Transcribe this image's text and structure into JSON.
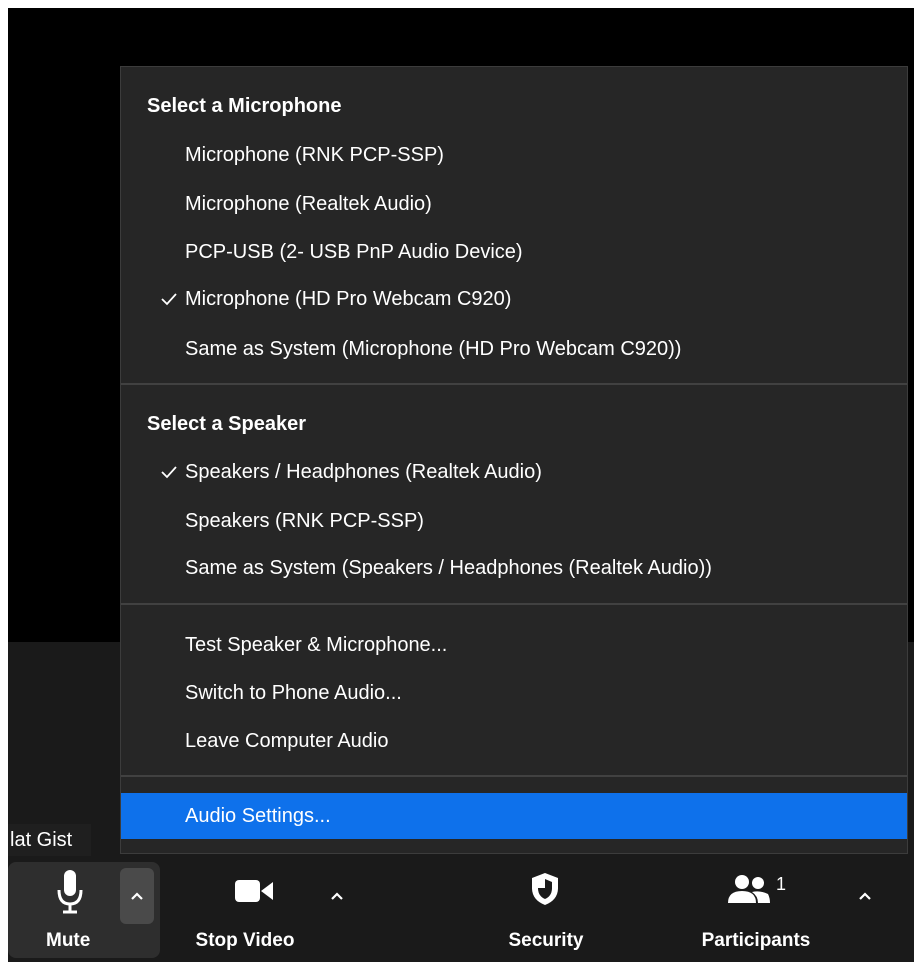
{
  "name_tag": "lat Gist",
  "menu": {
    "mic_header": "Select a Microphone",
    "mic_items": [
      {
        "label": "Microphone (RNK PCP-SSP)",
        "checked": false
      },
      {
        "label": "Microphone (Realtek Audio)",
        "checked": false
      },
      {
        "label": "PCP-USB (2- USB PnP Audio Device)",
        "checked": false
      },
      {
        "label": "Microphone (HD Pro Webcam C920)",
        "checked": true
      },
      {
        "label": "Same as System (Microphone (HD Pro Webcam C920))",
        "checked": false
      }
    ],
    "speaker_header": "Select a Speaker",
    "speaker_items": [
      {
        "label": "Speakers / Headphones (Realtek Audio)",
        "checked": true
      },
      {
        "label": "Speakers (RNK PCP-SSP)",
        "checked": false
      },
      {
        "label": "Same as System (Speakers / Headphones (Realtek Audio))",
        "checked": false
      }
    ],
    "actions": [
      "Test Speaker & Microphone...",
      "Switch to Phone Audio...",
      "Leave Computer Audio"
    ],
    "settings": "Audio Settings..."
  },
  "toolbar": {
    "mute": "Mute",
    "stop_video": "Stop Video",
    "security": "Security",
    "participants": "Participants",
    "participant_count": "1"
  },
  "colors": {
    "highlight": "#0e71eb",
    "menu_bg": "#262626",
    "toolbar_bg": "#1a1a1a"
  },
  "icons": [
    "microphone-icon",
    "video-camera-icon",
    "shield-icon",
    "participants-icon",
    "caret-up-icon",
    "checkmark-icon"
  ]
}
